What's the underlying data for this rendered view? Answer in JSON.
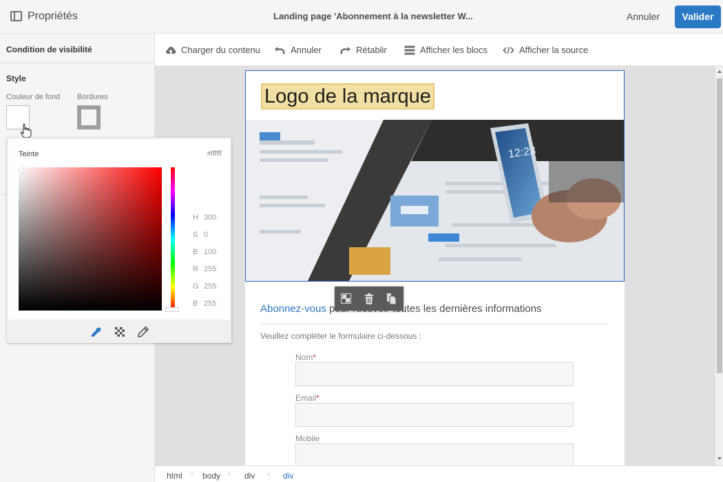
{
  "topbar": {
    "properties_title": "Propriétés",
    "document_title": "Landing page 'Abonnement à la newsletter W...",
    "cancel_label": "Annuler",
    "validate_label": "Valider"
  },
  "left_panel": {
    "visibility_condition": "Condition de visibilité",
    "style_heading": "Style",
    "background_color_label": "Couleur de fond",
    "borders_label": "Bordures"
  },
  "color_picker": {
    "hue_label": "Teinte",
    "hex": "#ffffff",
    "values": [
      {
        "key": "H",
        "value": "300"
      },
      {
        "key": "S",
        "value": "0"
      },
      {
        "key": "B",
        "value": "100"
      },
      {
        "key": "R",
        "value": "255"
      },
      {
        "key": "G",
        "value": "255"
      },
      {
        "key": "B",
        "value": "255"
      }
    ],
    "tools": [
      "eyedropper-icon",
      "transparency-icon",
      "pencil-icon"
    ]
  },
  "toolbar": {
    "load_content": "Charger du contenu",
    "undo": "Annuler",
    "redo": "Rétablir",
    "show_blocks": "Afficher les blocs",
    "show_source": "Afficher la source"
  },
  "page": {
    "logo_text": "Logo de la marque",
    "subscribe_link": "Abonnez-vous",
    "subscribe_rest": " pour recevoir toutes les dernières informations",
    "form_intro": "Veuillez compléter le formulaire ci-dessous :",
    "fields": [
      {
        "label": "Nom",
        "required": "*"
      },
      {
        "label": "Email",
        "required": "*"
      },
      {
        "label": "Mobile",
        "required": ""
      }
    ]
  },
  "breadcrumb": [
    "html",
    "body",
    "div",
    "div"
  ],
  "colors": {
    "accent": "#2b78c5",
    "selection_border": "#2b63c7",
    "logo_highlight": "#f2dfa3"
  }
}
